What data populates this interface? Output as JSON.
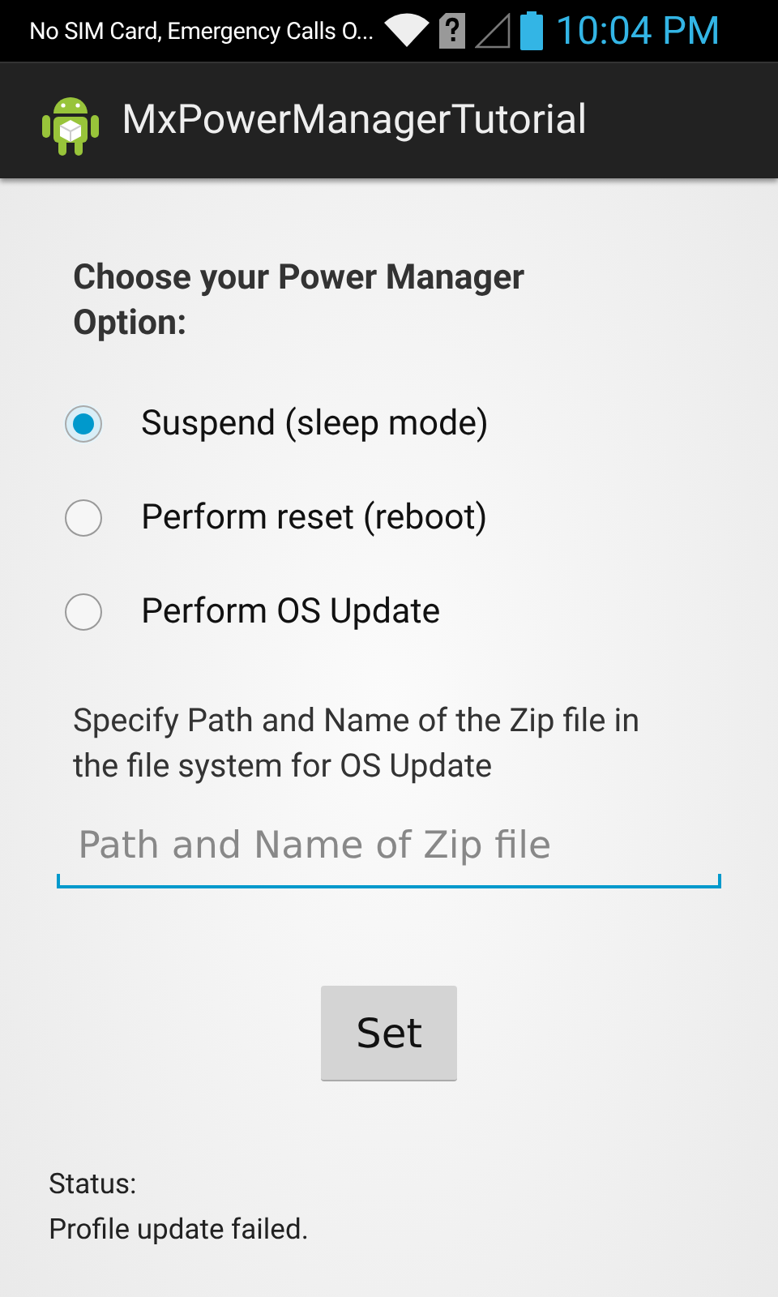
{
  "status_bar": {
    "notification": "No SIM Card, Emergency Calls O...",
    "time": "10:04 PM"
  },
  "action_bar": {
    "title": "MxPowerManagerTutorial"
  },
  "heading": "Choose your Power Manager Option:",
  "options": [
    {
      "label": "Suspend (sleep mode)",
      "selected": true
    },
    {
      "label": "Perform reset (reboot)",
      "selected": false
    },
    {
      "label": "Perform OS Update",
      "selected": false
    }
  ],
  "path_hint": "Specify Path and Name of the Zip file in the file system for OS Update",
  "path_field": {
    "placeholder": "Path and Name of Zip file"
  },
  "set_button": "Set",
  "status": {
    "label": "Status:",
    "message": "Profile update failed."
  }
}
